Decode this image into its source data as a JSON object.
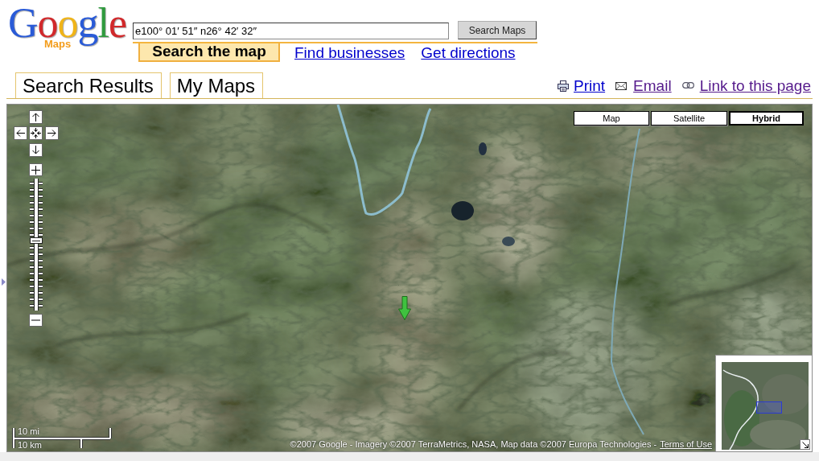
{
  "header": {
    "logo": {
      "wordmark": "Google",
      "product": "Maps"
    },
    "search": {
      "value": "e100° 01′ 51″ n26° 42′ 32″",
      "button": "Search Maps"
    },
    "search_tabs": [
      {
        "label": "Search the map",
        "selected": true
      },
      {
        "label": "Find businesses",
        "selected": false
      },
      {
        "label": "Get directions",
        "selected": false
      }
    ]
  },
  "panel_tabs": [
    {
      "label": "Search Results"
    },
    {
      "label": "My Maps"
    }
  ],
  "page_links": [
    {
      "kind": "print",
      "label": "Print",
      "visited": false
    },
    {
      "kind": "email",
      "label": "Email",
      "visited": true
    },
    {
      "kind": "link",
      "label": "Link to this page",
      "visited": true
    }
  ],
  "map": {
    "map_types": [
      {
        "label": "Map",
        "selected": false
      },
      {
        "label": "Satellite",
        "selected": false
      },
      {
        "label": "Hybrid",
        "selected": true
      }
    ],
    "zoom": {
      "level": 0.53
    },
    "scale": {
      "miles": "10 mi",
      "kilometers": "10 km"
    },
    "attribution": "©2007 Google - Imagery ©2007 TerraMetrics, NASA, Map data ©2007 Europa Technologies -",
    "terms_link": "Terms of Use",
    "overview": {
      "expanded": true
    }
  }
}
